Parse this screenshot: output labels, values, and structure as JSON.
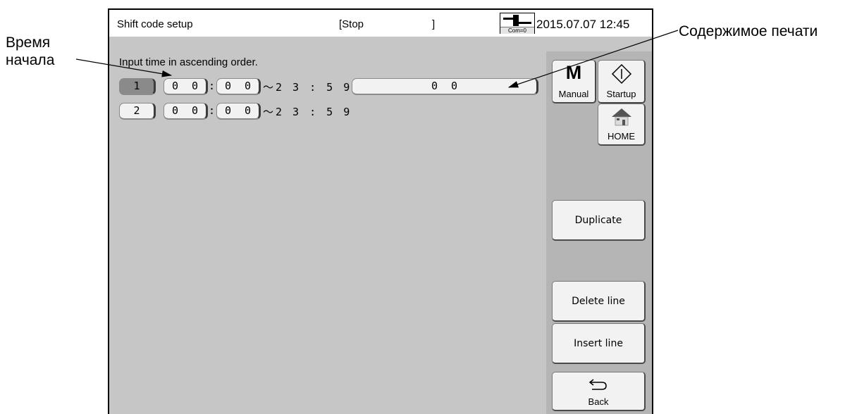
{
  "annotations": {
    "start_time_label": [
      "Время",
      "начала"
    ],
    "print_content_label": "Содержимое печати"
  },
  "titlebar": {
    "title": "Shift code setup",
    "status": "[Stop",
    "status_close": "]",
    "com_label": "Com=0",
    "datetime": "2015.07.07 12:45"
  },
  "hint": "Input time in ascending order.",
  "rows": [
    {
      "index": "1",
      "start_hour": "0 0",
      "start_minute": "0 0",
      "end_time": "～2 3 : 5 9",
      "print_content": "0 0",
      "selected": true
    },
    {
      "index": "2",
      "start_hour": "0 0",
      "start_minute": "0 0",
      "end_time": "～2 3 : 5 9",
      "selected": false
    }
  ],
  "sidebar": {
    "manual_letter": "M",
    "manual_label": "Manual",
    "startup_label": "Startup",
    "home_label": "HOME",
    "duplicate_label": "Duplicate",
    "delete_label": "Delete line",
    "insert_label": "Insert line",
    "back_label": "Back"
  },
  "colors": {
    "screen_bg": "#c6c6c6",
    "sidebar_bg": "#b5b5b5",
    "button_bg": "#f2f2f2",
    "selected_index_bg": "#8a8a8a"
  }
}
